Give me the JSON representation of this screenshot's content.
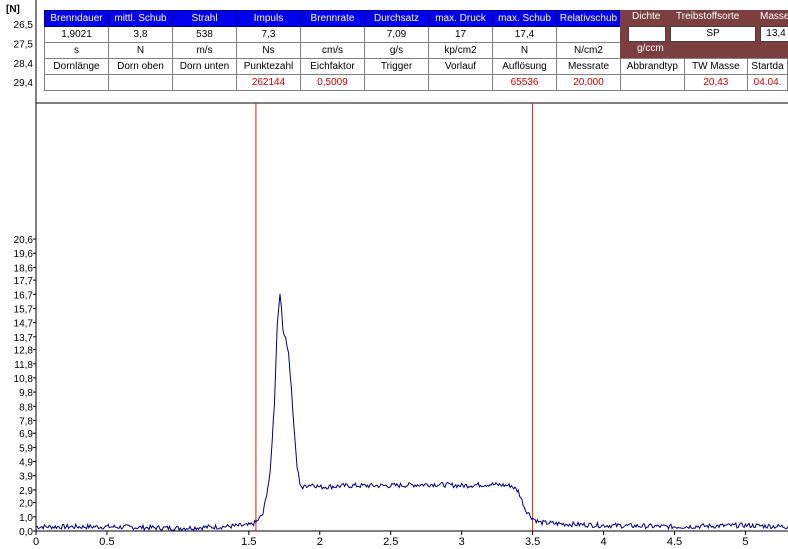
{
  "chart_data": {
    "type": "line",
    "ylabel": "[N]",
    "xlim": [
      0,
      5.3
    ],
    "ylim": [
      0,
      30.2
    ],
    "x_ticks": [
      {
        "v": 0,
        "label": "0"
      },
      {
        "v": 0.5,
        "label": "0.5"
      },
      {
        "v": 1.5,
        "label": "1.5"
      },
      {
        "v": 2,
        "label": "2"
      },
      {
        "v": 2.5,
        "label": "2.5"
      },
      {
        "v": 3,
        "label": "3"
      },
      {
        "v": 3.5,
        "label": "3.5"
      },
      {
        "v": 4,
        "label": "4"
      },
      {
        "v": 4.5,
        "label": "4.5"
      },
      {
        "v": 5,
        "label": "5"
      }
    ],
    "y_ticks": [
      "0,0",
      "1,0",
      "2,0",
      "2,9",
      "3,9",
      "4,9",
      "5,9",
      "6,9",
      "7,8",
      "8,8",
      "9,8",
      "10,8",
      "11,8",
      "12,8",
      "13,7",
      "14,7",
      "15,7",
      "16,7",
      "17,7",
      "18,6",
      "19,6",
      "20,6",
      "26,5",
      "27,5",
      "28,4",
      "29,4"
    ],
    "plot_y_ticks": [
      "0,0",
      "1,0",
      "2,0",
      "2,9",
      "3,9",
      "4,9",
      "5,9",
      "6,9",
      "7,8",
      "8,8",
      "9,8",
      "10,8",
      "11,8",
      "12,8",
      "13,7",
      "14,7",
      "15,7",
      "16,7",
      "17,7",
      "18,6",
      "19,6",
      "20,6"
    ],
    "markers": [
      1.55,
      3.5
    ],
    "series": [
      {
        "color": "#000080",
        "x": [
          0,
          0.5,
          1,
          1.3,
          1.5,
          1.55,
          1.6,
          1.65,
          1.68,
          1.7,
          1.72,
          1.74,
          1.76,
          1.78,
          1.8,
          1.82,
          1.84,
          1.86,
          1.88,
          1.9,
          1.95,
          2,
          2.2,
          2.5,
          2.8,
          3,
          3.2,
          3.35,
          3.4,
          3.45,
          3.5,
          3.55,
          3.7,
          4,
          4.5,
          5,
          5.3
        ],
        "y": [
          0.3,
          0.3,
          0.2,
          0.3,
          0.4,
          0.6,
          1.2,
          4,
          9,
          14.5,
          16.9,
          14.2,
          13.7,
          12.5,
          10,
          7,
          4.5,
          3.4,
          3,
          3.2,
          3.3,
          3.1,
          3.2,
          3.2,
          3.3,
          3.2,
          3.3,
          3.2,
          2.8,
          1.5,
          0.9,
          0.6,
          0.5,
          0.4,
          0.3,
          0.4,
          0.3
        ]
      }
    ]
  },
  "table": {
    "row1": [
      "Brenndauer",
      "mittl. Schub",
      "Strahl",
      "Impuls",
      "Brennrate",
      "Durchsatz",
      "max. Druck",
      "max. Schub",
      "Relativschub"
    ],
    "row2": [
      "1,9021",
      "3,8",
      "538",
      "7,3",
      "",
      "7,09",
      "17",
      "17,4",
      ""
    ],
    "row3": [
      "s",
      "N",
      "m/s",
      "Ns",
      "cm/s",
      "g/s",
      "kp/cm2",
      "N",
      "N/cm2"
    ],
    "row4": [
      "Dornlänge",
      "Dorn oben",
      "Dorn unten",
      "Punktezahl",
      "Eichfaktor",
      "Trigger",
      "Vorlauf",
      "Auflösung",
      "Messrate"
    ],
    "row5": [
      "",
      "",
      "",
      "262144",
      "0,5009",
      "",
      "",
      "65536",
      "20,000"
    ]
  },
  "right_panel": {
    "headers": [
      "Dichte",
      "Treibstoffsorte",
      "Masse"
    ],
    "values": [
      "",
      "SP",
      "13,4"
    ],
    "unit": "g/ccm",
    "row4": [
      "Abbrandtyp",
      "TW Masse",
      "Startda"
    ],
    "row5": [
      "",
      "20,43",
      "04.04."
    ]
  }
}
